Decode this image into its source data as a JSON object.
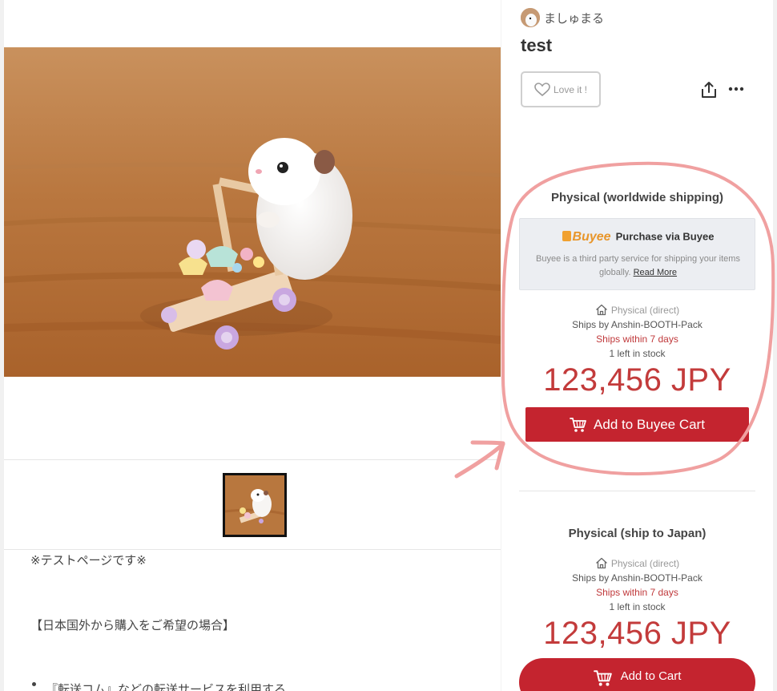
{
  "shop": {
    "name": "ましゅまる",
    "avatar_icon": "hamster-avatar-icon"
  },
  "item": {
    "title": "test"
  },
  "actions": {
    "love_label": "Love it !",
    "share_icon": "share-icon",
    "more_icon": "more-icon"
  },
  "description": {
    "lines": [
      "※テストページです※",
      "【日本国外から購入をご希望の場合】",
      "『転送コム』などの転送サービスを利用する"
    ]
  },
  "worldwide": {
    "heading": "Physical (worldwide shipping)",
    "buyee": {
      "logo": "Buyee",
      "title": "Purchase via Buyee",
      "note": "Buyee is a third party service for shipping your items globally.",
      "read_more": "Read More"
    },
    "type": "Physical (direct)",
    "ships_by": "Ships by Anshin-BOOTH-Pack",
    "ships_within": "Ships within 7 days",
    "stock": "1 left in stock",
    "price": "123,456 JPY",
    "button": "Add to Buyee Cart"
  },
  "japan": {
    "heading": "Physical (ship to Japan)",
    "type": "Physical (direct)",
    "ships_by": "Ships by Anshin-BOOTH-Pack",
    "ships_within": "Ships within 7 days",
    "stock": "1 left in stock",
    "price": "123,456 JPY",
    "button": "Add to Cart"
  },
  "colors": {
    "accent": "#c4242f",
    "price": "#c33b3b",
    "annotation": "#f0a0a0",
    "buyee": "#e8962b"
  }
}
